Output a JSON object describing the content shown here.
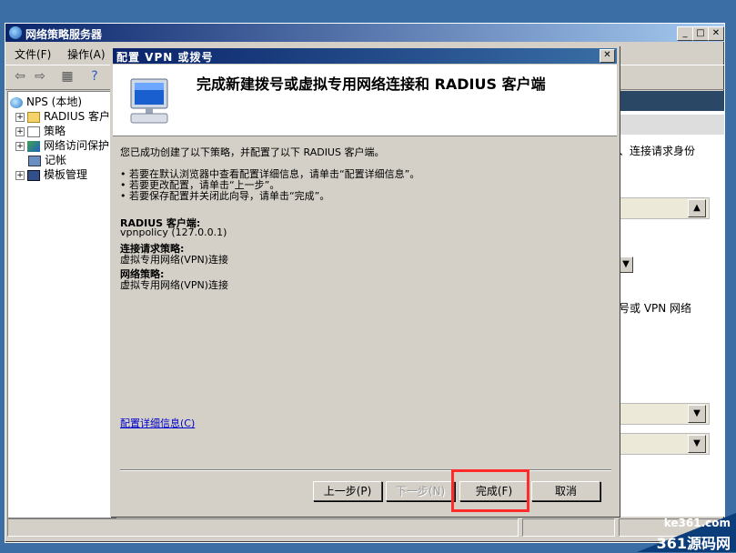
{
  "main_window": {
    "title": "网络策略服务器",
    "menu": {
      "file": "文件(F)",
      "action": "操作(A)"
    }
  },
  "tree": {
    "items": [
      {
        "label": "NPS (本地)",
        "icon": "globe-icon"
      },
      {
        "label": "RADIUS 客户端",
        "icon": "folder-icon"
      },
      {
        "label": "策略",
        "icon": "document-icon"
      },
      {
        "label": "网络访问保护",
        "icon": "shield-icon"
      },
      {
        "label": "记帐",
        "icon": "log-icon"
      },
      {
        "label": "模板管理",
        "icon": "templates-icon"
      }
    ]
  },
  "right_pane": {
    "text1": "、连接请求身份",
    "text2": "号或 VPN 网络"
  },
  "wizard": {
    "title": "配置 VPN 或拨号",
    "heading": "完成新建拨号或虚拟专用网络连接和 RADIUS 客户端",
    "intro": "您已成功创建了以下策略，并配置了以下 RADIUS 客户端。",
    "bullets": [
      "• 若要在默认浏览器中查看配置详细信息，请单击“配置详细信息”。",
      "• 若要更改配置，请单击“上一步”。",
      "• 若要保存配置并关闭此向导，请单击“完成”。"
    ],
    "radius_label": "RADIUS 客户端:",
    "radius_value": "vpnpolicy (127.0.0.1)",
    "conn_label": "连接请求策略:",
    "conn_value": "虚拟专用网络(VPN)连接",
    "net_label": "网络策略:",
    "net_value": "虚拟专用网络(VPN)连接",
    "details_link": "配置详细信息(C)",
    "buttons": {
      "back": "上一步(P)",
      "next": "下一步(N)",
      "finish": "完成(F)",
      "cancel": "取消"
    }
  },
  "watermark": {
    "url": "ke361.com",
    "name": "361源码网"
  },
  "colors": {
    "desktop": "#3a6ea5",
    "highlight": "#ff2a2a",
    "title_bar": "#0a246a"
  }
}
